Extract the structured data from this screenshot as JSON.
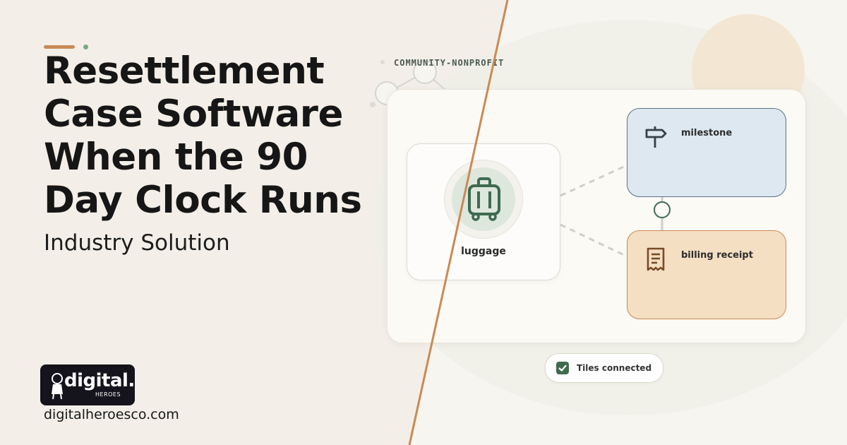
{
  "hero": {
    "title": "Resettlement Case Software When the 90 Day Clock Runs",
    "subtitle": "Industry Solution",
    "category": "COMMUNITY-NONPROFIT"
  },
  "brand": {
    "logo_text": "digital.",
    "logo_subtext": "HEROES",
    "website": "digitalheroesco.com"
  },
  "diagram": {
    "main_tile": {
      "label": "luggage",
      "icon": "luggage-icon"
    },
    "tiles": [
      {
        "label": "milestone",
        "icon": "signpost-icon"
      },
      {
        "label": "billing receipt",
        "icon": "receipt-icon"
      }
    ]
  },
  "status": {
    "text": "Tiles connected",
    "icon": "check-icon"
  },
  "colors": {
    "accent": "#c98a55",
    "green": "#3f6a4f",
    "blue_tile": "#dde8f0",
    "orange_tile": "#f4dfc3"
  }
}
